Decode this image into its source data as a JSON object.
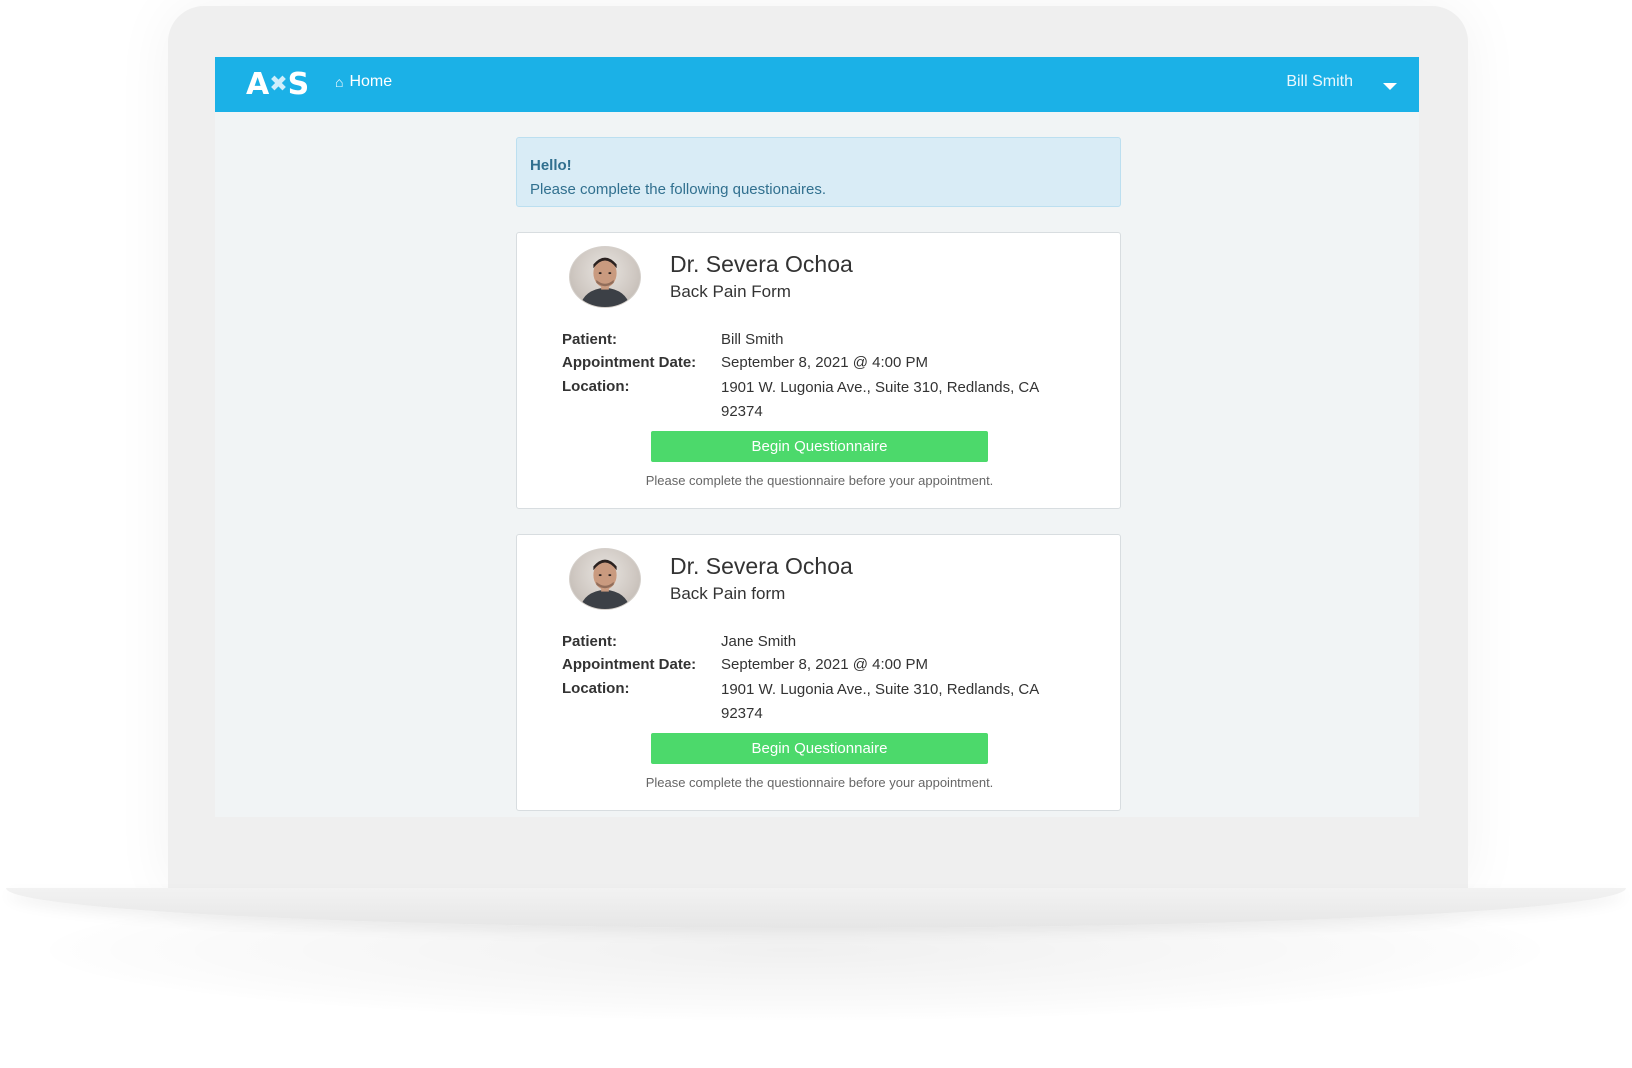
{
  "navbar": {
    "brand_left": "A",
    "brand_mark": "✖",
    "brand_right": "S",
    "home_label": "Home",
    "user_name": "Bill Smith"
  },
  "alert": {
    "title": "Hello!",
    "message": "Please complete the following questionaires."
  },
  "labels": {
    "patient": "Patient:",
    "appointment_date": "Appointment Date:",
    "location": "Location:"
  },
  "cards": [
    {
      "doctor": "Dr. Severa Ochoa",
      "form": "Back Pain Form",
      "patient": "Bill Smith",
      "appointment_date": "September 8, 2021 @ 4:00 PM",
      "location": "1901 W. Lugonia Ave., Suite 310, Redlands, CA 92374",
      "button_label": "Begin Questionnaire",
      "help": "Please complete the questionnaire before your appointment."
    },
    {
      "doctor": "Dr. Severa Ochoa",
      "form": "Back Pain form",
      "patient": "Jane Smith",
      "appointment_date": "September 8, 2021 @ 4:00 PM",
      "location": "1901 W. Lugonia Ave., Suite 310, Redlands, CA 92374",
      "button_label": "Begin Questionnaire",
      "help": "Please complete the questionnaire before your appointment."
    }
  ],
  "colors": {
    "navbar": "#1bb1e7",
    "alert_bg": "#d9ecf6",
    "alert_text": "#31708f",
    "button": "#4cd96b"
  }
}
